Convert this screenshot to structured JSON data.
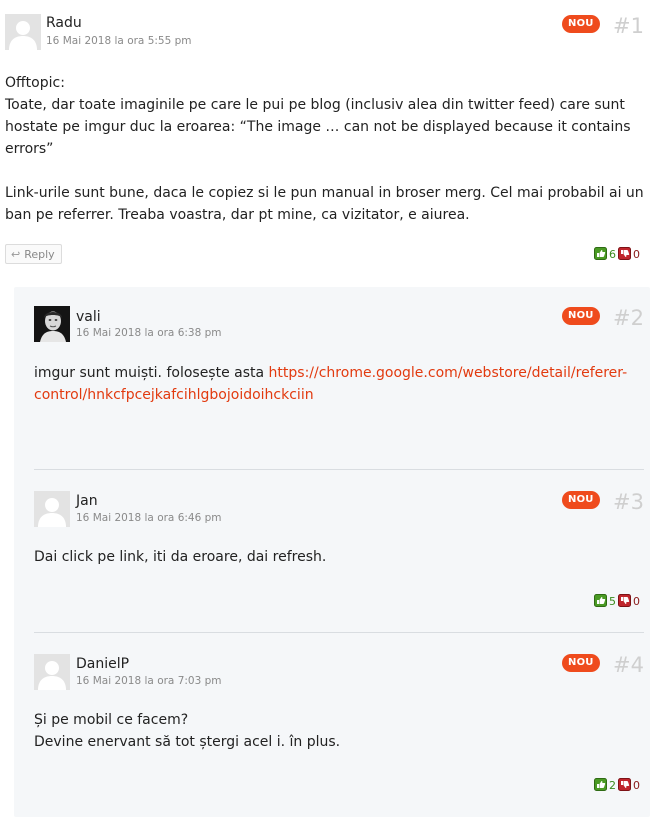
{
  "colors": {
    "accent": "#ef4b1d",
    "link": "#e23a0f",
    "upvote": "#3b8b1e",
    "downvote": "#8a1a1a"
  },
  "labels": {
    "reply": "Reply",
    "new_badge": "NOU"
  },
  "comments": [
    {
      "author": "Radu",
      "date": "16 Mai 2018 la ora 5:55 pm",
      "number": "#1",
      "paragraphs": [
        "Offtopic:",
        "Toate, dar toate imaginile pe care le pui pe blog (inclusiv alea din twitter feed) care sunt hostate pe imgur duc la eroarea: “The image … can not be displayed because it contains errors”",
        "",
        "Link-urile sunt bune, daca le copiez si le pun manual in broser merg. Cel mai probabil ai un ban pe referrer. Treaba voastra, dar pt mine, ca vizitator, e aiurea."
      ],
      "upvotes": "6",
      "downvotes": "0",
      "avatar_icon": "default-avatar-icon"
    },
    {
      "author": "vali",
      "date": "16 Mai 2018 la ora 6:38 pm",
      "number": "#2",
      "text_before_link": "imgur sunt muiști. folosește asta ",
      "link": "https://chrome.google.com/webstore/detail/referer-control/hnkcfpcejkafcihlgbojoidoihckciin",
      "avatar_icon": "user-photo-avatar"
    },
    {
      "author": "Jan",
      "date": "16 Mai 2018 la ora 6:46 pm",
      "number": "#3",
      "paragraphs": [
        "Dai click pe link, iti da eroare, dai refresh."
      ],
      "upvotes": "5",
      "downvotes": "0",
      "avatar_icon": "default-avatar-icon"
    },
    {
      "author": "DanielP",
      "date": "16 Mai 2018 la ora 7:03 pm",
      "number": "#4",
      "paragraphs": [
        "Și pe mobil ce facem?",
        "Devine enervant să tot ștergi acel i. în plus."
      ],
      "upvotes": "2",
      "downvotes": "0",
      "avatar_icon": "default-avatar-icon"
    }
  ]
}
